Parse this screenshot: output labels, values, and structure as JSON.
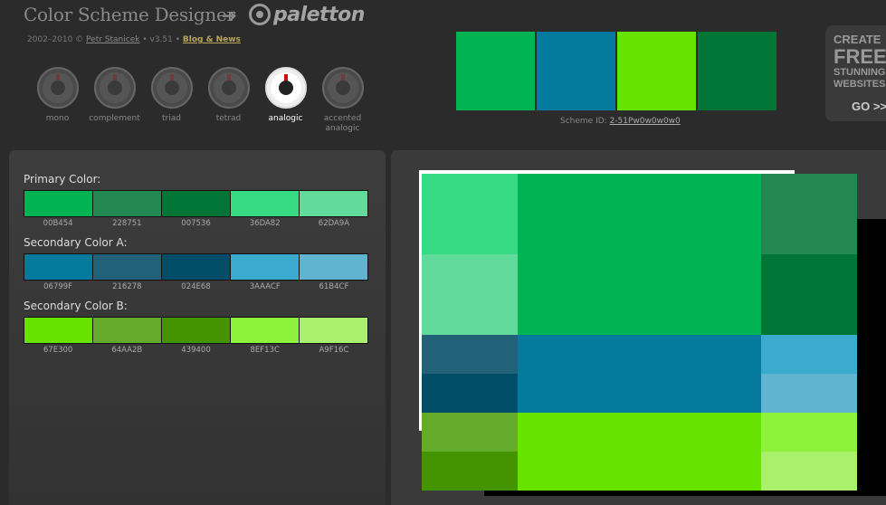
{
  "header": {
    "app_title": "Color Scheme Designer",
    "logo_text": "paletton",
    "credits_prefix": "2002–2010 ©",
    "credits_author": "Petr Stanicek",
    "credits_version": "• v3.51 •",
    "credits_blog": "Blog & News"
  },
  "schemes": [
    {
      "label": "mono",
      "active": false
    },
    {
      "label": "complement",
      "active": false
    },
    {
      "label": "triad",
      "active": false
    },
    {
      "label": "tetrad",
      "active": false
    },
    {
      "label": "analogic",
      "active": true
    },
    {
      "label": "accented analogic",
      "active": false
    }
  ],
  "preview": {
    "colors": [
      "#00B454",
      "#06799F",
      "#67E300",
      "#007536"
    ],
    "scheme_id_label": "Scheme ID:",
    "scheme_id": "2-51Pw0w0w0w0"
  },
  "ad": {
    "line1": "CREATE",
    "line2": "FREE",
    "line3": "STUNNING",
    "line4": "WEBSITES",
    "go": "GO >>"
  },
  "groups": [
    {
      "title": "Primary Color:",
      "codes": [
        "00B454",
        "228751",
        "007536",
        "36DA82",
        "62DA9A"
      ],
      "colors": [
        "#00B454",
        "#228751",
        "#007536",
        "#36DA82",
        "#62DA9A"
      ]
    },
    {
      "title": "Secondary Color A:",
      "codes": [
        "06799F",
        "216278",
        "024E68",
        "3AAACF",
        "61B4CF"
      ],
      "colors": [
        "#06799F",
        "#216278",
        "#024E68",
        "#3AAACF",
        "#61B4CF"
      ]
    },
    {
      "title": "Secondary Color B:",
      "codes": [
        "67E300",
        "64AA2B",
        "439400",
        "8EF13C",
        "A9F16C"
      ],
      "colors": [
        "#67E300",
        "#64AA2B",
        "#439400",
        "#8EF13C",
        "#A9F16C"
      ]
    }
  ],
  "sample": {
    "blocks": [
      {
        "name": "sample-primary-light-1",
        "color": "#36DA82"
      },
      {
        "name": "sample-primary-main",
        "color": "#00B454"
      },
      {
        "name": "sample-primary-dark-1",
        "color": "#228751"
      },
      {
        "name": "sample-primary-light-2",
        "color": "#62DA9A"
      },
      {
        "name": "sample-primary-dark-2",
        "color": "#007536"
      },
      {
        "name": "sample-a-dark-1",
        "color": "#216278"
      },
      {
        "name": "sample-a-main",
        "color": "#06799F"
      },
      {
        "name": "sample-a-light-1",
        "color": "#3AAACF"
      },
      {
        "name": "sample-a-dark-2",
        "color": "#024E68"
      },
      {
        "name": "sample-a-light-2",
        "color": "#61B4CF"
      },
      {
        "name": "sample-b-dark-1",
        "color": "#64AA2B"
      },
      {
        "name": "sample-b-main",
        "color": "#67E300"
      },
      {
        "name": "sample-b-light-1",
        "color": "#8EF13C"
      },
      {
        "name": "sample-b-dark-2",
        "color": "#439400"
      },
      {
        "name": "sample-b-light-2",
        "color": "#A9F16C"
      }
    ]
  }
}
